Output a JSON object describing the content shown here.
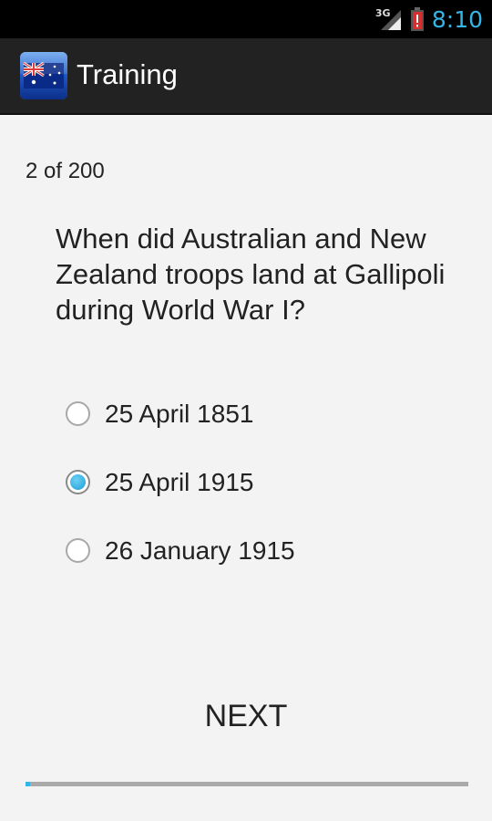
{
  "status_bar": {
    "network_type": "3G",
    "signal_icon": "signal-strength-icon",
    "battery_icon": "battery-low-icon",
    "time": "8:10",
    "clock_color": "#33b5e5"
  },
  "action_bar": {
    "app_icon": "australia-flag-icon",
    "title": "Training"
  },
  "quiz": {
    "progress_label": "2 of 200",
    "current": 2,
    "total": 200,
    "question": "When did Australian and New Zealand troops land at Gallipoli during World War I?",
    "options": [
      {
        "label": "25 April 1851",
        "selected": false
      },
      {
        "label": "25 April 1915",
        "selected": true
      },
      {
        "label": "26 January 1915",
        "selected": false
      }
    ],
    "next_label": "NEXT"
  },
  "colors": {
    "accent": "#33b5e5",
    "action_bar_bg": "#222222",
    "content_bg": "#f3f3f3",
    "battery_warning": "#d32f2f"
  }
}
